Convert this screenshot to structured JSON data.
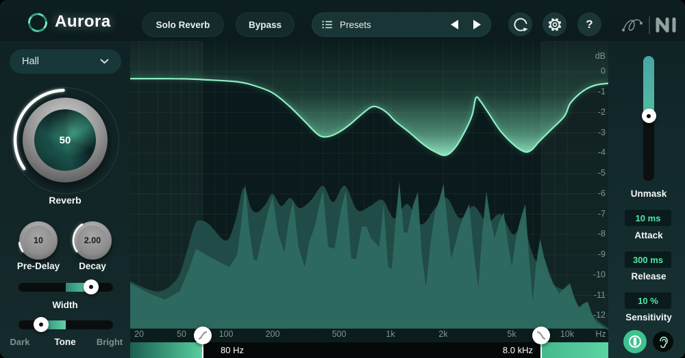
{
  "topbar": {
    "logo_text": "Aurora",
    "solo_button": "Solo Reverb",
    "bypass_button": "Bypass",
    "presets_label": "Presets",
    "help_label": "?",
    "icons": [
      "list-icon",
      "prev-preset-arrow",
      "next-preset-arrow",
      "history-icon",
      "gear-icon",
      "help-icon",
      "izotope-logo",
      "ni-logo"
    ]
  },
  "left_panel": {
    "room_select": {
      "value": "Hall",
      "icon": "chevron-down-icon"
    },
    "reverb_knob": {
      "value": "50",
      "label": "Reverb"
    },
    "predelay_knob": {
      "value": "10",
      "label": "Pre-Delay"
    },
    "decay_knob": {
      "value": "2.00",
      "label": "Decay"
    },
    "width_slider": {
      "label": "Width",
      "value_pct": 77,
      "fill_start_pct": 50
    },
    "tone_slider": {
      "label": "Tone",
      "left_label": "Dark",
      "right_label": "Bright",
      "value_pct": 24,
      "fill_end_pct": 50
    }
  },
  "right_panel": {
    "unmask_slider": {
      "label": "Unmask",
      "value_pct": 48
    },
    "attack": {
      "value": "10 ms",
      "label": "Attack"
    },
    "release": {
      "value": "300 ms",
      "label": "Release"
    },
    "sensitivity": {
      "value": "10 %",
      "label": "Sensitivity"
    },
    "icons": [
      "power-icon",
      "ear-icon"
    ]
  },
  "colors": {
    "accent_teal": "#54cf9f",
    "curve_mint": "#8bf1c4",
    "value_green": "#4fe9a7",
    "spectrum_front": "#2f6b61",
    "spectrum_back": "#23514b"
  },
  "chart_data": {
    "type": "line",
    "title": "Reverb EQ curve over input spectrum",
    "x_axis": {
      "scale": "log",
      "unit_label": "Hz",
      "range_hz": [
        17,
        16700
      ],
      "ticks": [
        {
          "label": "20",
          "f": 20
        },
        {
          "label": "50",
          "f": 50
        },
        {
          "label": "100",
          "f": 100
        },
        {
          "label": "200",
          "f": 200
        },
        {
          "label": "500",
          "f": 500
        },
        {
          "label": "1k",
          "f": 1000
        },
        {
          "label": "2k",
          "f": 2000
        },
        {
          "label": "5k",
          "f": 5000
        },
        {
          "label": "10k",
          "f": 10000
        }
      ]
    },
    "y_axis": {
      "unit_label": "dB",
      "range_db": [
        0,
        -12
      ],
      "ticks": [
        "0",
        "-1",
        "-2",
        "-3",
        "-4",
        "-5",
        "-6",
        "-7",
        "-8",
        "-9",
        "-10",
        "-11",
        "-12"
      ]
    },
    "grid": true,
    "markers": {
      "low_cut": {
        "freq": 80,
        "label": "80 Hz"
      },
      "high_cut": {
        "freq": 8000,
        "label": "8.0 kHz"
      }
    },
    "series": [
      {
        "name": "eq-curve",
        "type": "line",
        "color": "#8bf1c4",
        "points": [
          [
            17,
            -0.33
          ],
          [
            33,
            -0.33
          ],
          [
            55,
            -0.34
          ],
          [
            81,
            -0.38
          ],
          [
            117,
            -0.48
          ],
          [
            153,
            -0.68
          ],
          [
            200,
            -1.03
          ],
          [
            251,
            -1.67
          ],
          [
            312,
            -2.44
          ],
          [
            366,
            -3.02
          ],
          [
            401,
            -3.19
          ],
          [
            446,
            -3.15
          ],
          [
            509,
            -2.92
          ],
          [
            585,
            -2.55
          ],
          [
            678,
            -2.08
          ],
          [
            772,
            -1.73
          ],
          [
            847,
            -1.74
          ],
          [
            956,
            -2.01
          ],
          [
            1075,
            -2.45
          ],
          [
            1290,
            -2.99
          ],
          [
            1540,
            -3.56
          ],
          [
            1770,
            -3.9
          ],
          [
            2060,
            -4.1
          ],
          [
            2350,
            -3.72
          ],
          [
            2700,
            -2.85
          ],
          [
            2950,
            -2.1
          ],
          [
            3100,
            -1.27
          ],
          [
            3300,
            -1.45
          ],
          [
            3650,
            -2.0
          ],
          [
            4300,
            -2.9
          ],
          [
            5200,
            -3.6
          ],
          [
            6170,
            -3.93
          ],
          [
            6880,
            -3.83
          ],
          [
            7760,
            -3.42
          ],
          [
            8740,
            -2.82
          ],
          [
            9760,
            -2.18
          ],
          [
            10350,
            -1.57
          ],
          [
            11570,
            -1.1
          ],
          [
            12920,
            -0.8
          ],
          [
            14570,
            -0.63
          ],
          [
            16700,
            -0.56
          ]
        ]
      },
      {
        "name": "spectrum-front",
        "type": "area",
        "color": "#2f6b61",
        "points": [
          [
            17,
            -10.4
          ],
          [
            25,
            -10.9
          ],
          [
            35,
            -11.2
          ],
          [
            48,
            -10.8
          ],
          [
            58,
            -9.8
          ],
          [
            69,
            -8.7
          ],
          [
            80,
            -8.9
          ],
          [
            92,
            -9.3
          ],
          [
            105,
            -9.6
          ],
          [
            118,
            -9.0
          ],
          [
            126,
            -7.3
          ],
          [
            133,
            -5.5
          ],
          [
            140,
            -7.5
          ],
          [
            150,
            -9.2
          ],
          [
            158,
            -9.3
          ],
          [
            170,
            -8.2
          ],
          [
            185,
            -7.0
          ],
          [
            200,
            -6.1
          ],
          [
            215,
            -7.9
          ],
          [
            235,
            -8.9
          ],
          [
            250,
            -7.3
          ],
          [
            266,
            -6.3
          ],
          [
            285,
            -8.6
          ],
          [
            312,
            -9.6
          ],
          [
            330,
            -8.4
          ],
          [
            358,
            -7.6
          ],
          [
            380,
            -6.6
          ],
          [
            401,
            -5.8
          ],
          [
            430,
            -8.6
          ],
          [
            470,
            -8.7
          ],
          [
            510,
            -6.9
          ],
          [
            548,
            -5.8
          ],
          [
            590,
            -9.2
          ],
          [
            630,
            -9.2
          ],
          [
            680,
            -7.6
          ],
          [
            724,
            -7.6
          ],
          [
            770,
            -8.2
          ],
          [
            860,
            -8.6
          ],
          [
            912,
            -6.5
          ],
          [
            970,
            -9.6
          ],
          [
            1018,
            -9.7
          ],
          [
            1080,
            -6.9
          ],
          [
            1124,
            -5.4
          ],
          [
            1190,
            -7.9
          ],
          [
            1252,
            -7.9
          ],
          [
            1340,
            -6.6
          ],
          [
            1433,
            -5.9
          ],
          [
            1510,
            -9.0
          ],
          [
            1596,
            -10.6
          ],
          [
            1700,
            -8.3
          ],
          [
            1795,
            -6.9
          ],
          [
            1900,
            -6.3
          ],
          [
            2009,
            -5.5
          ],
          [
            2120,
            -7.5
          ],
          [
            2225,
            -9.2
          ],
          [
            2360,
            -8.4
          ],
          [
            2496,
            -7.6
          ],
          [
            2660,
            -7.0
          ],
          [
            2836,
            -6.5
          ],
          [
            3000,
            -8.8
          ],
          [
            3197,
            -10.6
          ],
          [
            3380,
            -7.8
          ],
          [
            3566,
            -5.9
          ],
          [
            3760,
            -7.2
          ],
          [
            3977,
            -8.2
          ],
          [
            4230,
            -7.4
          ],
          [
            4491,
            -6.9
          ],
          [
            4750,
            -8.4
          ],
          [
            5019,
            -9.6
          ],
          [
            5290,
            -8.4
          ],
          [
            5583,
            -7.6
          ],
          [
            5890,
            -7.0
          ],
          [
            6222,
            -6.5
          ],
          [
            6600,
            -9.2
          ],
          [
            6994,
            -11.3
          ],
          [
            7400,
            -9.4
          ],
          [
            7861,
            -8.2
          ],
          [
            8200,
            -9.1
          ],
          [
            8568,
            -9.9
          ],
          [
            8940,
            -10.5
          ],
          [
            9330,
            -10.9
          ],
          [
            9840,
            -10.6
          ],
          [
            10350,
            -10.4
          ],
          [
            10940,
            -11.1
          ],
          [
            11570,
            -11.6
          ],
          [
            12220,
            -11.4
          ],
          [
            12920,
            -11.3
          ],
          [
            13620,
            -11.9
          ],
          [
            14370,
            -12.3
          ],
          [
            15480,
            -12.5
          ],
          [
            16700,
            -12.7
          ]
        ]
      },
      {
        "name": "spectrum-back",
        "type": "area",
        "color": "#23514b",
        "points": [
          [
            17,
            -10.3
          ],
          [
            30,
            -10.8
          ],
          [
            45,
            -10.2
          ],
          [
            55,
            -9.0
          ],
          [
            66,
            -7.6
          ],
          [
            75,
            -7.3
          ],
          [
            85,
            -7.5
          ],
          [
            100,
            -8.3
          ],
          [
            115,
            -7.3
          ],
          [
            130,
            -5.7
          ],
          [
            145,
            -6.7
          ],
          [
            160,
            -6.9
          ],
          [
            180,
            -6.5
          ],
          [
            200,
            -6.0
          ],
          [
            225,
            -6.6
          ],
          [
            255,
            -6.2
          ],
          [
            290,
            -6.7
          ],
          [
            340,
            -6.3
          ],
          [
            400,
            -5.6
          ],
          [
            460,
            -6.4
          ],
          [
            540,
            -5.6
          ],
          [
            640,
            -6.8
          ],
          [
            760,
            -6.6
          ],
          [
            900,
            -6.3
          ],
          [
            1050,
            -7.2
          ],
          [
            1250,
            -6.5
          ],
          [
            1500,
            -7.5
          ],
          [
            1800,
            -6.7
          ],
          [
            2100,
            -6.2
          ],
          [
            2500,
            -7.2
          ],
          [
            3000,
            -6.6
          ],
          [
            3600,
            -7.4
          ],
          [
            4300,
            -7.0
          ],
          [
            5100,
            -8.0
          ],
          [
            6000,
            -7.5
          ],
          [
            7000,
            -9.0
          ],
          [
            8000,
            -9.6
          ],
          [
            9000,
            -10.5
          ],
          [
            10000,
            -10.8
          ],
          [
            11500,
            -11.5
          ],
          [
            13000,
            -11.8
          ],
          [
            15000,
            -12.3
          ],
          [
            16700,
            -12.6
          ]
        ]
      }
    ]
  }
}
